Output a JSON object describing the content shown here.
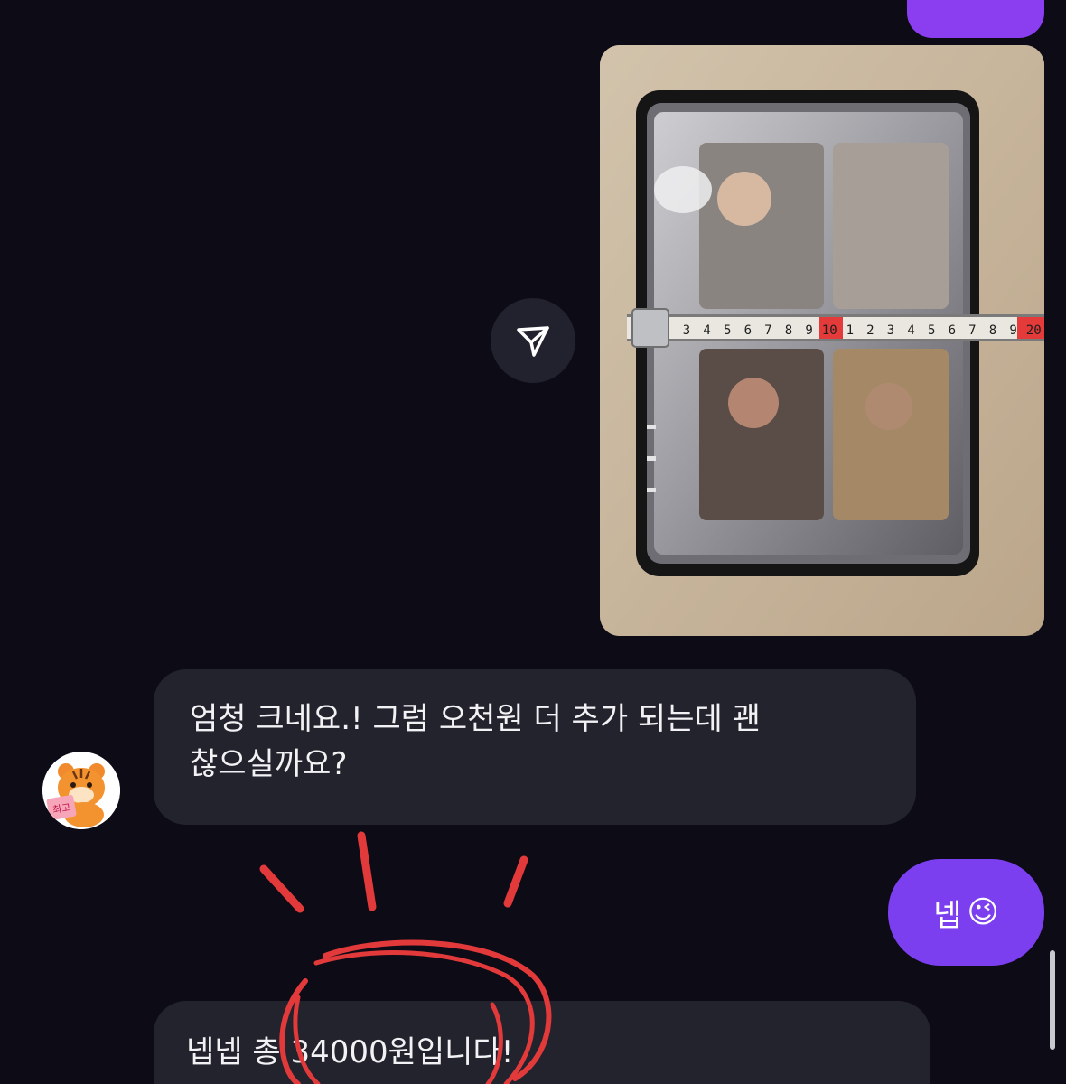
{
  "messages": {
    "image_message": {
      "ruler_digits": [
        "3",
        "4",
        "5",
        "6",
        "7",
        "8",
        "9",
        "10",
        "1",
        "2",
        "3",
        "4",
        "5",
        "6",
        "7",
        "8",
        "9",
        "20"
      ]
    },
    "received_1": {
      "line1": "엄청 크네요.! 그럼 오천원 더 추가 되는데 괜",
      "line2": "찮으실까요?"
    },
    "sent_reply": {
      "text": "넵",
      "emoji": "😉"
    },
    "received_2": {
      "text": "넵넵 총 34000원입니다!"
    }
  },
  "avatar": {
    "label": "최고"
  },
  "share_button": {
    "icon": "send-icon"
  },
  "colors": {
    "background": "#0c0b16",
    "received_bubble": "#23232e",
    "sent_bubble": "#7c3ff0",
    "annotation_red": "#e23a3a"
  }
}
